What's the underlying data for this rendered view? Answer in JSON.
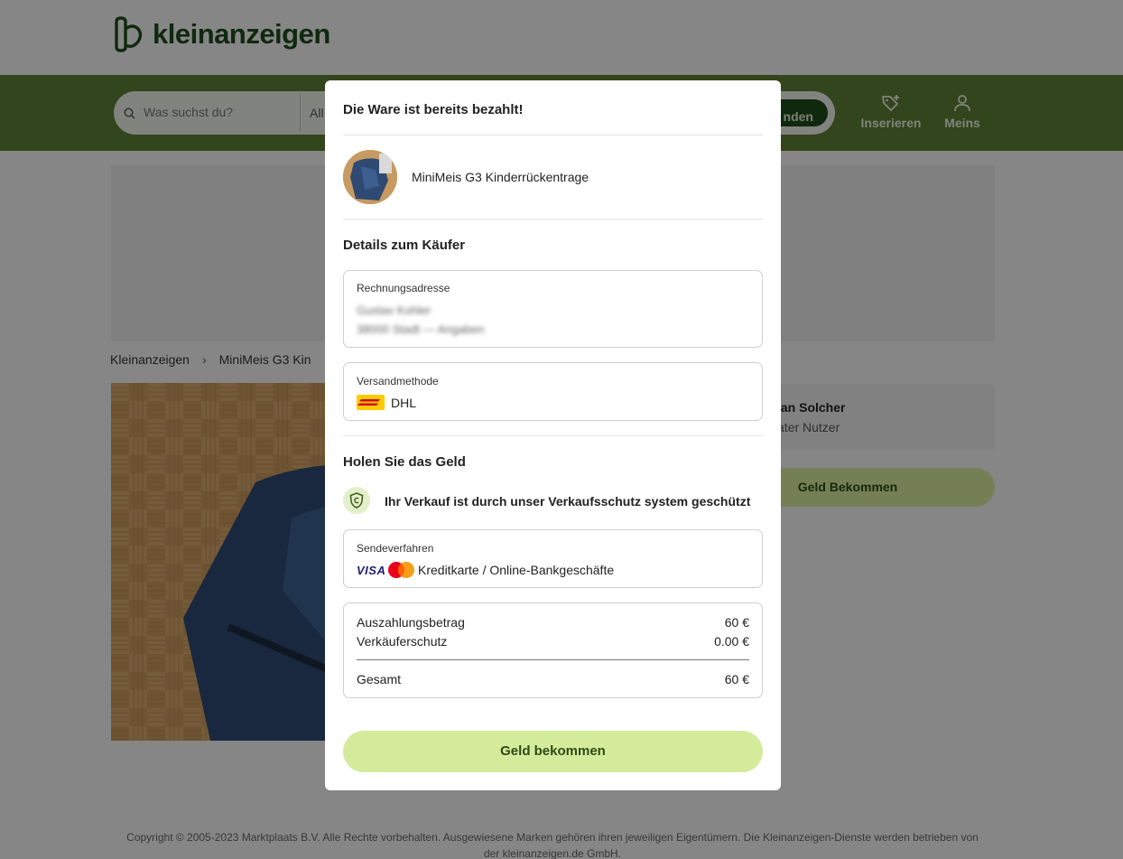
{
  "header": {
    "logo_text": "kleinanzeigen",
    "search_placeholder": "Was suchst du?",
    "category_value": "All",
    "find_label": "nden",
    "nav": {
      "insert_label": "Inserieren",
      "meins_label": "Meins"
    }
  },
  "page": {
    "breadcrumb": [
      "Kleinanzeigen",
      "MiniMeis G3 Kin"
    ],
    "seller_name": "ian Solcher",
    "seller_type": "ater Nutzer",
    "seller_action_label": "Geld Bekommen"
  },
  "modal": {
    "title": "Die Ware ist bereits bezahlt!",
    "product_name": "MiniMeis G3 Kinderrückentrage",
    "buyer_section_title": "Details zum Käufer",
    "billing_label": "Rechnungsadresse",
    "billing_line1": "Gustav Kohler",
    "billing_line2": "38000 Stadt — Angaben",
    "shipping_label": "Versandmethode",
    "shipping_value": "DHL",
    "money_section_title": "Holen Sie das Geld",
    "protection_text": "Ihr Verkauf ist durch unser Verkaufsschutz system geschützt",
    "payout_method_label": "Sendeverfahren",
    "payout_method_value": "Kreditkarte / Online-Bankgeschäfte",
    "visa_text": "VISA",
    "summary": {
      "payout_label": "Auszahlungsbetrag",
      "payout_amount": "60 €",
      "protection_label": "Verkäuferschutz",
      "protection_amount": "0.00 €",
      "total_label": "Gesamt",
      "total_amount": "60 €"
    },
    "cta_label": "Geld bekommen"
  },
  "footer": {
    "copyright": "Copyright © 2005-2023 Marktplaats B.V. Alle Rechte vorbehalten. Ausgewiesene Marken gehören ihren jeweiligen Eigentümern. Die Kleinanzeigen-Dienste werden betrieben von der kleinanzeigen.de GmbH."
  },
  "colors": {
    "brand_green": "#5c7f34",
    "brand_dark": "#1d4b1d",
    "cta_green": "#d4eb9b",
    "dhl_yellow": "#ffcc00",
    "dhl_red": "#d40511"
  }
}
